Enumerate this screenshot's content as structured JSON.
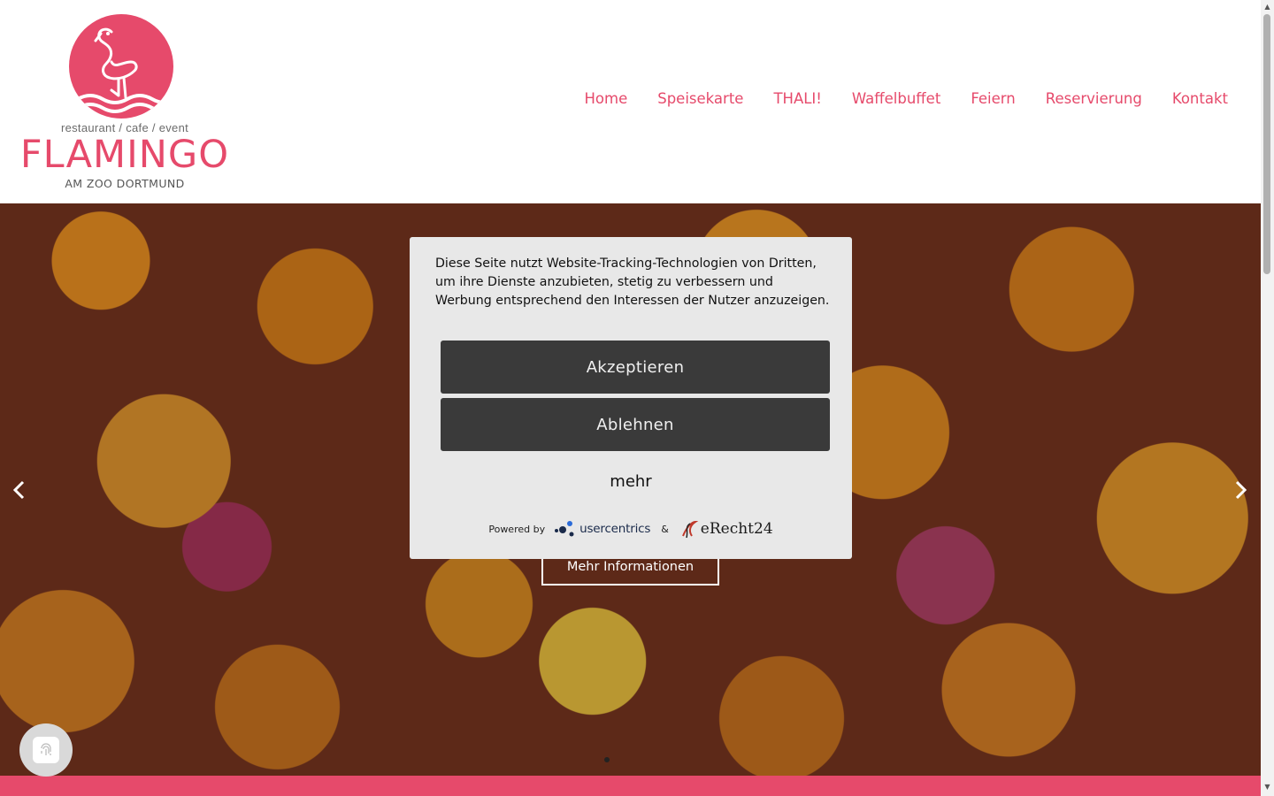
{
  "brand": {
    "sub": "restaurant / cafe / event",
    "name": "FLAMINGO",
    "place": "AM ZOO DORTMUND",
    "color": "#e64a6b"
  },
  "nav": {
    "items": [
      {
        "label": "Home"
      },
      {
        "label": "Speisekarte"
      },
      {
        "label": "THALI!"
      },
      {
        "label": "Waffelbuffet"
      },
      {
        "label": "Feiern"
      },
      {
        "label": "Reservierung"
      },
      {
        "label": "Kontakt"
      }
    ]
  },
  "hero": {
    "more_info_label": "Mehr Informationen",
    "prev_icon": "chevron-left-icon",
    "next_icon": "chevron-right-icon"
  },
  "cookie": {
    "text": "Diese Seite nutzt Website-Tracking-Technologien von Dritten, um ihre Dienste anzubieten, stetig zu verbessern und Werbung entsprechend den Interessen der Nutzer anzuzeigen.",
    "accept_label": "Akzeptieren",
    "decline_label": "Ablehnen",
    "more_label": "mehr",
    "powered_by": "Powered by",
    "usercentrics": "usercentrics",
    "amp": "&",
    "erecht": "eRecht24"
  },
  "privacy_button": {
    "icon": "fingerprint-icon"
  }
}
